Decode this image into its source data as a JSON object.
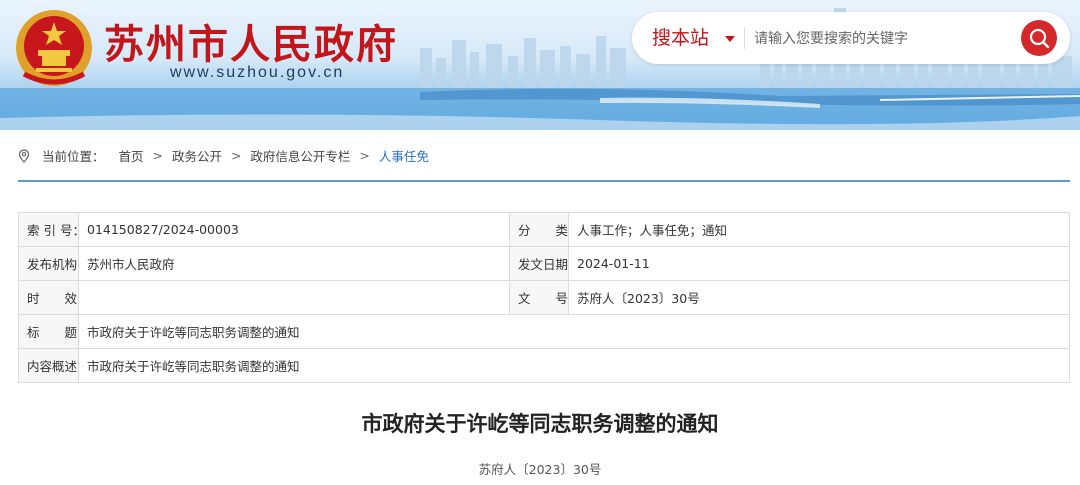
{
  "header": {
    "site_title": "苏州市人民政府",
    "site_url": "www.suzhou.gov.cn",
    "search": {
      "scope_label": "搜本站",
      "placeholder": "请输入您要搜索的关键字"
    }
  },
  "breadcrumb": {
    "prefix": "当前位置：",
    "items": [
      "首页",
      "政务公开",
      "政府信息公开专栏",
      "人事任免"
    ],
    "separator": ">"
  },
  "info": {
    "rows": [
      {
        "label": "索 引 号：",
        "value": "014150827/2024-00003",
        "label2": "分　　类：",
        "value2": "人事工作；人事任免；通知"
      },
      {
        "label": "发布机构：",
        "value": "苏州市人民政府",
        "label2": "发文日期：",
        "value2": "2024-01-11"
      },
      {
        "label": "时　　效：",
        "value": "",
        "label2": "文　　号：",
        "value2": "苏府人〔2023〕30号"
      },
      {
        "label": "标　　题：",
        "value": "市政府关于许屹等同志职务调整的通知"
      },
      {
        "label": "内容概述：",
        "value": "市政府关于许屹等同志职务调整的通知"
      }
    ]
  },
  "article": {
    "title": "市政府关于许屹等同志职务调整的通知",
    "doc_number": "苏府人〔2023〕30号"
  },
  "colors": {
    "brand_red": "#c2161b",
    "link_blue": "#2a6fc2",
    "rule_blue": "#5b9bd8"
  },
  "icons": {
    "emblem": "national-emblem-icon",
    "location": "location-pin-icon",
    "search": "search-icon",
    "caret": "caret-down-icon"
  }
}
